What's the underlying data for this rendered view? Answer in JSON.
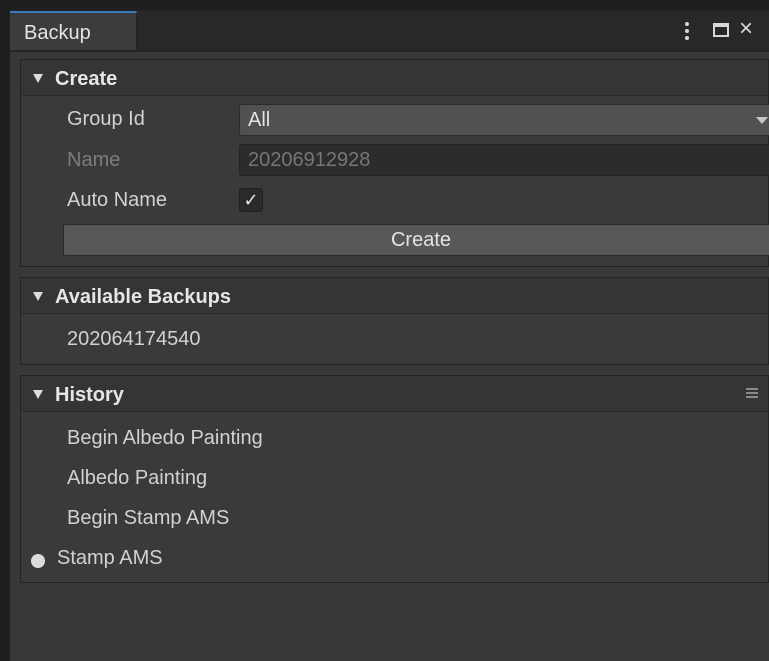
{
  "window": {
    "tab_title": "Backup",
    "kebab_icon": "kebab-menu-icon",
    "maximize_icon": "maximize-icon",
    "close_icon": "close-icon",
    "close_glyph": "×"
  },
  "create": {
    "title": "Create",
    "group_id": {
      "label": "Group Id",
      "value": "All"
    },
    "name": {
      "label": "Name",
      "value": "20206912928"
    },
    "auto_name": {
      "label": "Auto Name",
      "checked": true,
      "glyph": "✓"
    },
    "create_button": "Create"
  },
  "available_backups": {
    "title": "Available Backups",
    "items": [
      "202064174540"
    ]
  },
  "history": {
    "title": "History",
    "menu_icon": "list-menu-icon",
    "items": [
      "Begin Albedo Painting",
      "Albedo Painting",
      "Begin Stamp AMS",
      "Stamp AMS"
    ],
    "current_index": 3
  },
  "colors": {
    "window_bg": "#383838",
    "tab_accent": "#3a79bb",
    "button_bg": "#585858",
    "field_bg": "#2c2c2c",
    "text": "#d2d2d2",
    "disabled_text": "#7c7c7c"
  }
}
